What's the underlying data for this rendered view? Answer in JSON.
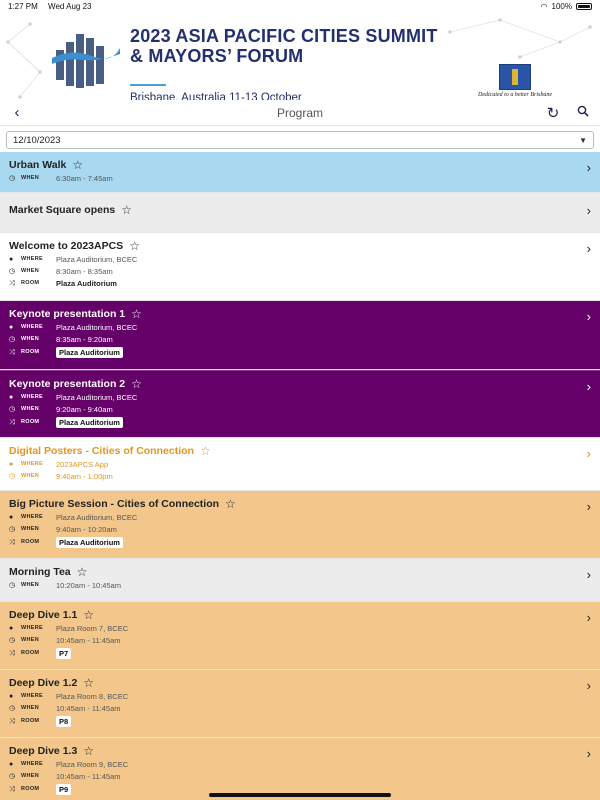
{
  "status_bar": {
    "time": "1:27 PM",
    "date": "Wed Aug 23",
    "battery": "100%"
  },
  "banner": {
    "title_line1": "2023 ASIA PACIFIC CITIES SUMMIT",
    "title_line2": "& MAYORS’ FORUM",
    "subtitle": "Brisbane, Australia   11-13 October",
    "city_tagline": "Dedicated to a better Brisbane"
  },
  "nav": {
    "title": "Program"
  },
  "date_select": {
    "value": "12/10/2023"
  },
  "colors": {
    "blue": "#a8d9f0",
    "purple": "#650069",
    "peach": "#f3c78c",
    "orange_text": "#e39520",
    "navy": "#22306e"
  },
  "sessions": [
    {
      "title": "Urban Walk",
      "when": "6:30am - 7:45am"
    },
    {
      "title": "Market Square opens"
    },
    {
      "title": "Welcome to 2023APCS",
      "where": "Plaza Auditorium, BCEC",
      "when": "8:30am - 8:35am",
      "room": "Plaza Auditorium"
    },
    {
      "title": "Keynote presentation 1",
      "where": "Plaza Auditorium, BCEC",
      "when": "8:35am - 9:20am",
      "room": "Plaza Auditorium"
    },
    {
      "title": "Keynote presentation 2",
      "where": "Plaza Auditorium, BCEC",
      "when": "9:20am - 9:40am",
      "room": "Plaza Auditorium"
    },
    {
      "title": "Digital Posters - Cities of Connection",
      "where": "2023APCS App",
      "when": "9:40am - 1:00pm"
    },
    {
      "title": "Big Picture Session - Cities of Connection",
      "where": "Plaza Auditorium, BCEC",
      "when": "9:40am - 10:20am",
      "room": "Plaza Auditorium"
    },
    {
      "title": "Morning Tea",
      "when": "10:20am - 10:45am"
    },
    {
      "title": "Deep Dive 1.1",
      "where": "Plaza Room 7, BCEC",
      "when": "10:45am - 11:45am",
      "room": "P7"
    },
    {
      "title": "Deep Dive 1.2",
      "where": "Plaza Room 8, BCEC",
      "when": "10:45am - 11:45am",
      "room": "P8"
    },
    {
      "title": "Deep Dive 1.3",
      "where": "Plaza Room 9, BCEC",
      "when": "10:45am - 11:45am",
      "room": "P9"
    }
  ],
  "labels": {
    "where": "WHERE",
    "when": "WHEN",
    "room": "ROOM"
  },
  "icons": {
    "back": "chevron-left-icon",
    "refresh": "refresh-icon",
    "search": "search-icon",
    "star": "star-outline-icon",
    "chevron": "chevron-right-icon",
    "pin": "location-pin-icon",
    "clock": "clock-icon",
    "room": "shuffle-icon"
  }
}
